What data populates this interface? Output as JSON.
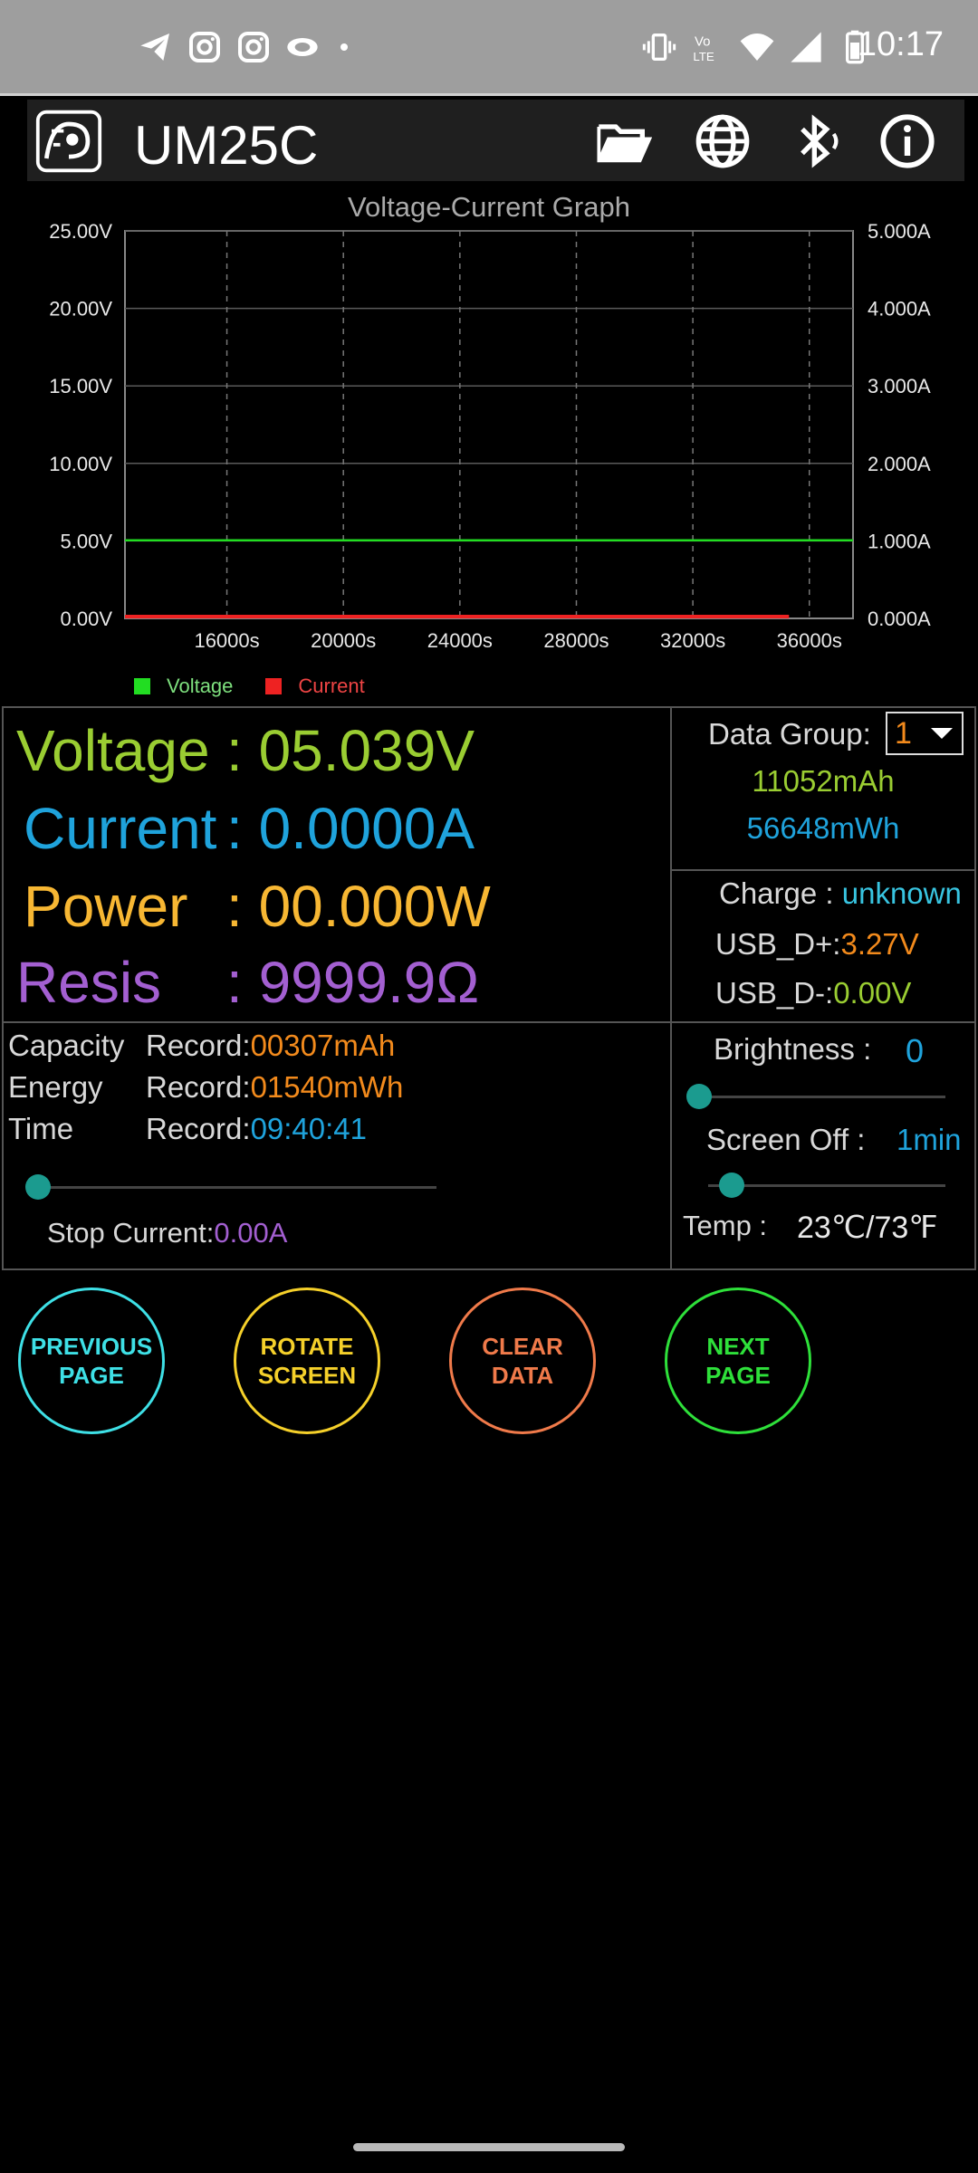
{
  "status_bar": {
    "time": "10:17",
    "notification_icons": [
      "telegram-icon",
      "instagram-icon",
      "instagram-icon",
      "app-eye-icon",
      "dot-icon"
    ],
    "system_icons": [
      "vibrate-icon",
      "volte-icon",
      "wifi-icon",
      "signal-icon",
      "battery-icon"
    ]
  },
  "app_bar": {
    "title": "UM25C",
    "icons": [
      "folder-open-icon",
      "globe-icon",
      "bluetooth-icon",
      "info-icon"
    ]
  },
  "chart_data": {
    "type": "line",
    "title": "Voltage-Current Graph",
    "x_ticks": [
      "16000s",
      "20000s",
      "24000s",
      "28000s",
      "32000s",
      "36000s"
    ],
    "y_left_ticks": [
      "0.00V",
      "5.00V",
      "10.00V",
      "15.00V",
      "20.00V",
      "25.00V"
    ],
    "y_right_ticks": [
      "0.000A",
      "1.000A",
      "2.000A",
      "3.000A",
      "4.000A",
      "5.000A"
    ],
    "y_left_range": [
      0,
      25
    ],
    "y_right_range": [
      0,
      5
    ],
    "x_range": [
      12500,
      37500
    ],
    "series": [
      {
        "name": "Voltage",
        "color": "#22dd22",
        "x": [
          12500,
          37500
        ],
        "y": [
          5.039,
          5.039
        ],
        "axis": "left"
      },
      {
        "name": "Current",
        "color": "#ee2222",
        "x": [
          12500,
          35300
        ],
        "y": [
          0.0,
          0.0
        ],
        "axis": "right"
      }
    ],
    "grid": true,
    "legend_placement": "bottom-left"
  },
  "readings": {
    "voltage_label": "Voltage",
    "voltage_value": ": 05.039V",
    "current_label": "Current",
    "current_value": ": 0.0000A",
    "power_label": "Power",
    "power_value": ": 00.000W",
    "resis_label": "Resis",
    "resis_value": ": 9999.9Ω"
  },
  "data_group": {
    "label": "Data Group:",
    "selected": "1",
    "mah": "11052mAh",
    "mwh": "56648mWh"
  },
  "charge": {
    "label": "Charge :",
    "value": "unknown",
    "usb_dp_label": "USB_D+:",
    "usb_dp_value": "3.27V",
    "usb_dm_label": "USB_D-:",
    "usb_dm_value": "0.00V"
  },
  "records": {
    "capacity_key": "Capacity",
    "capacity_rec": "Record:",
    "capacity_value": "00307mAh",
    "energy_key": "Energy",
    "energy_rec": "Record:",
    "energy_value": "01540mWh",
    "time_key": "Time",
    "time_rec": "Record:",
    "time_value": "09:40:41",
    "stop_current_label": "Stop Current:",
    "stop_current_value": "0.00A",
    "stop_current_slider": 0.0
  },
  "display": {
    "brightness_label": "Brightness :",
    "brightness_value": "0",
    "brightness_slider": 0.0,
    "screen_off_label": "Screen Off :",
    "screen_off_value": "1min",
    "screen_off_slider": 0.1,
    "temp_label": "Temp :",
    "temp_value": "23℃/73℉"
  },
  "buttons": {
    "previous_page": "PREVIOUS\nPAGE",
    "rotate_screen": "ROTATE\nSCREEN",
    "clear_data": "CLEAR\nDATA",
    "next_page": "NEXT\nPAGE"
  },
  "colors": {
    "voltage": "#9acd32",
    "current": "#1fa3dc",
    "power": "#f7b733",
    "resis": "#a35fd1",
    "orange": "#f28a1c",
    "cyan": "#38c4e0",
    "btn_previous": "#3ee0e6",
    "btn_rotate": "#f5d02a",
    "btn_clear": "#f07a4a",
    "btn_next": "#2ee03a"
  }
}
